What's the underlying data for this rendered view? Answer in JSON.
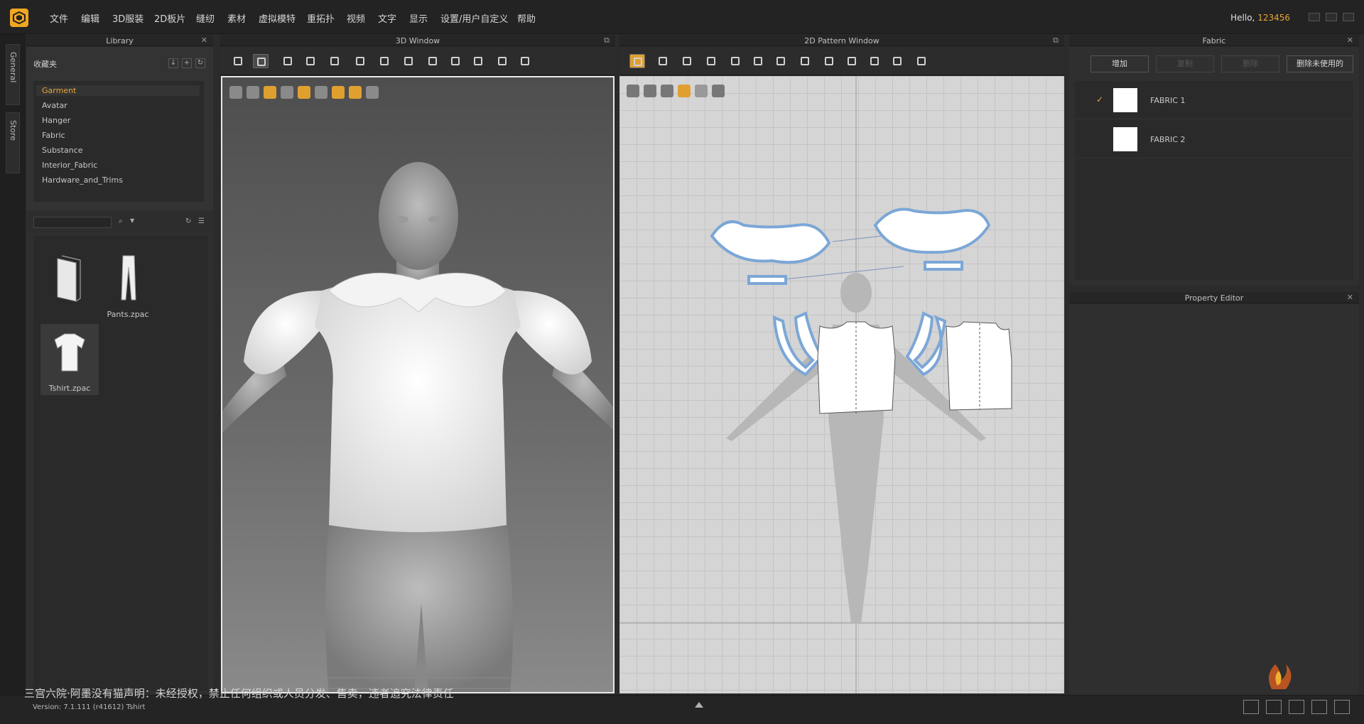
{
  "app": {
    "greeting_prefix": "Hello,",
    "username": "123456",
    "accent": "#f0a623"
  },
  "menu": [
    "文件",
    "编辑",
    "3D服装",
    "2D板片",
    "缝纫",
    "素材",
    "虚拟模特",
    "重拓扑",
    "视频",
    "文字",
    "显示",
    "设置/用户自定义",
    "帮助"
  ],
  "side_tabs": [
    "General",
    "Store"
  ],
  "library": {
    "title": "Library",
    "folder_label": "收藏夹",
    "tree": [
      "Garment",
      "Avatar",
      "Hanger",
      "Fabric",
      "Substance",
      "Interior_Fabric",
      "Hardware_and_Trims"
    ],
    "selected": "Garment",
    "files": [
      {
        "label": "",
        "icon": "folder-icon"
      },
      {
        "label": "Pants.zpac",
        "icon": "pants-icon"
      },
      {
        "label": "Tshirt.zpac",
        "icon": "tshirt-icon"
      }
    ]
  },
  "window3d": {
    "title": "3D Window"
  },
  "window2d": {
    "title": "2D Pattern Window"
  },
  "fabric": {
    "title": "Fabric",
    "buttons": [
      "增加",
      "复制",
      "删除",
      "删除未使用的"
    ],
    "items": [
      {
        "name": "FABRIC 1",
        "checked": true,
        "color": "#ffffff"
      },
      {
        "name": "FABRIC 2",
        "checked": false,
        "color": "#ffffff"
      }
    ]
  },
  "property_editor": {
    "title": "Property Editor"
  },
  "status": {
    "notice": "三宫六院·阿墨没有猫声明：未经授权，禁止任何组织或人员分发、售卖，违者追究法律责任",
    "version_label": "Version:",
    "version": "7.1.111 (r41612)",
    "file": "Tshirt"
  }
}
